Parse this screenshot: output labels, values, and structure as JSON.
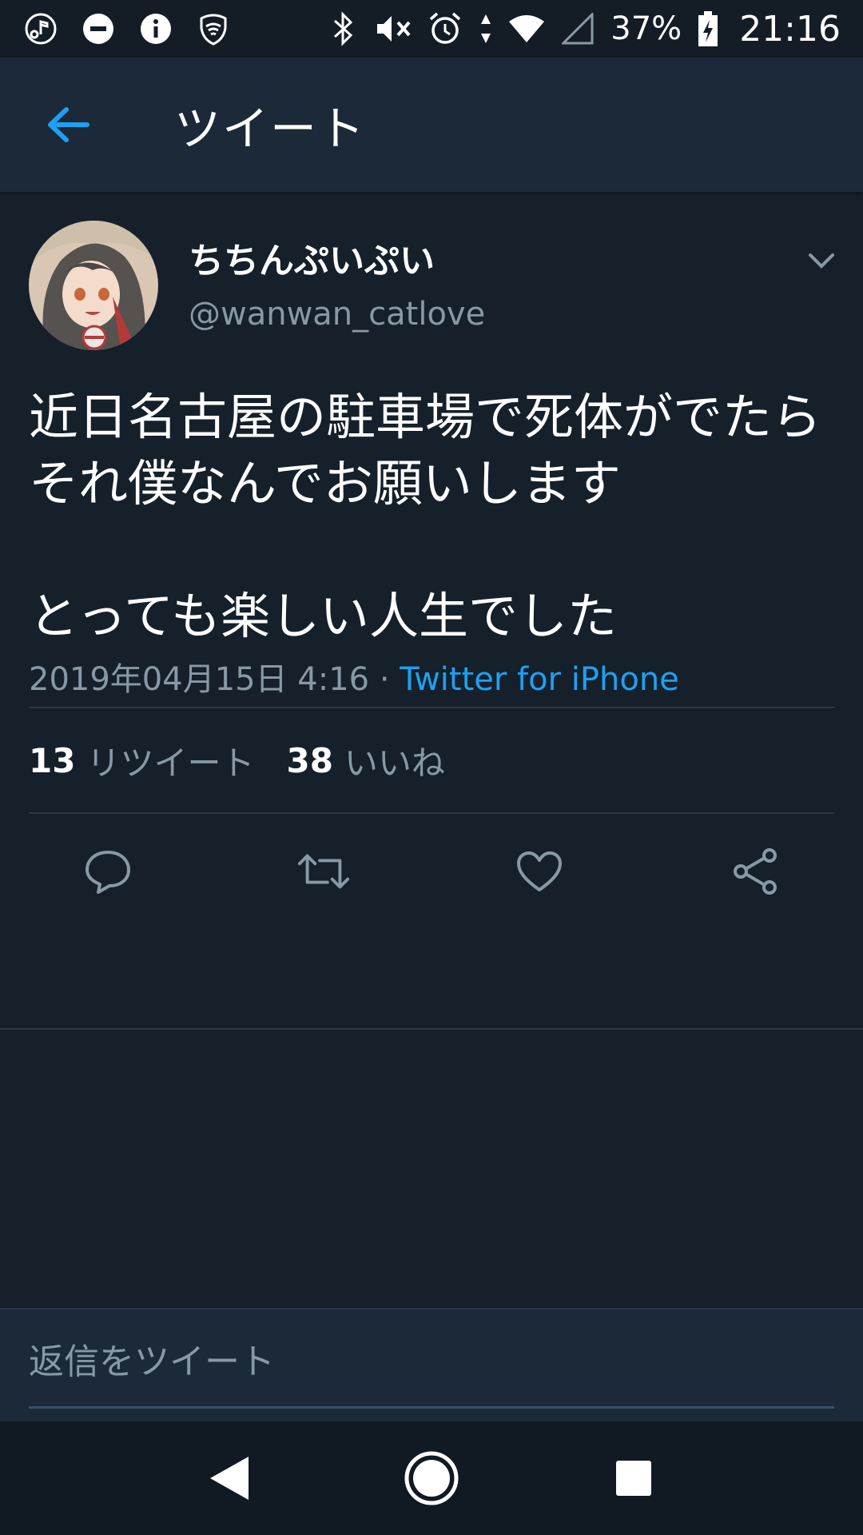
{
  "status_bar": {
    "battery": "37%",
    "time": "21:16",
    "left_icons": [
      "music-icon",
      "do-not-disturb-icon",
      "info-icon",
      "vpn-shield-icon"
    ],
    "right_icons": [
      "bluetooth-icon",
      "mute-icon",
      "alarm-icon",
      "data-arrows-icon",
      "wifi-icon",
      "signal-icon",
      "battery-charging-icon"
    ]
  },
  "header": {
    "title": "ツイート",
    "back_icon": "arrow-left-icon"
  },
  "tweet": {
    "display_name": "ちちんぷいぷい",
    "handle": "@wanwan_catlove",
    "text": "近日名古屋の駐車場で死体がでたら\nそれ僕なんでお願いします\n\nとっても楽しい人生でした",
    "date": "2019年04月15日 4:16 · ",
    "source": "Twitter for iPhone",
    "retweets_count": "13",
    "retweets_label": "リツイート",
    "likes_count": "38",
    "likes_label": "いいね"
  },
  "actions": [
    "reply-icon",
    "retweet-icon",
    "like-icon",
    "share-icon"
  ],
  "reply": {
    "placeholder": "返信をツイート"
  },
  "colors": {
    "background": "#15202b",
    "header": "#1c2938",
    "accent": "#1da1f2",
    "secondary_text": "#8899a6",
    "divider": "#2a3744"
  }
}
